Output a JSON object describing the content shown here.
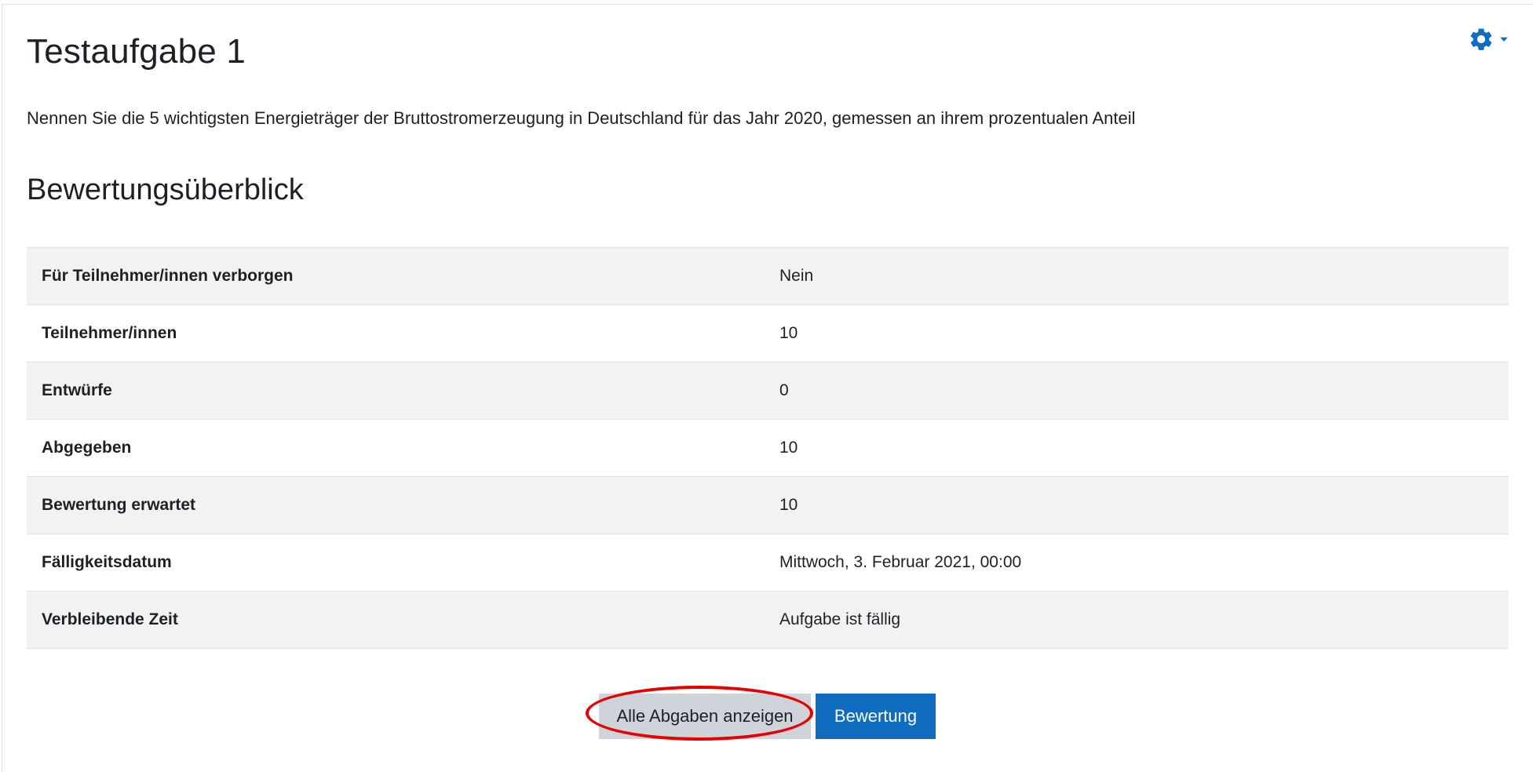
{
  "page": {
    "title": "Testaufgabe 1",
    "intro": "Nennen Sie die 5 wichtigsten Energieträger der Bruttostromerzeugung in Deutschland für das Jahr 2020, gemessen an ihrem prozentualen Anteil",
    "section_title": "Bewertungsüberblick"
  },
  "actions_menu": {
    "icon": "gear-icon",
    "caret": "caret-down-icon",
    "color": "#0f6cbf"
  },
  "summary": {
    "rows": [
      {
        "label": "Für Teilnehmer/innen verborgen",
        "value": "Nein"
      },
      {
        "label": "Teilnehmer/innen",
        "value": "10"
      },
      {
        "label": "Entwürfe",
        "value": "0"
      },
      {
        "label": "Abgegeben",
        "value": "10"
      },
      {
        "label": "Bewertung erwartet",
        "value": "10"
      },
      {
        "label": "Fälligkeitsdatum",
        "value": "Mittwoch, 3. Februar 2021, 00:00"
      },
      {
        "label": "Verbleibende Zeit",
        "value": "Aufgabe ist fällig"
      }
    ]
  },
  "buttons": {
    "view_all": "Alle Abgaben anzeigen",
    "grade": "Bewertung"
  },
  "colors": {
    "primary": "#0f6cbf",
    "secondary": "#ced4da",
    "highlight": "#e60000",
    "row_stripe": "#f2f2f2"
  }
}
